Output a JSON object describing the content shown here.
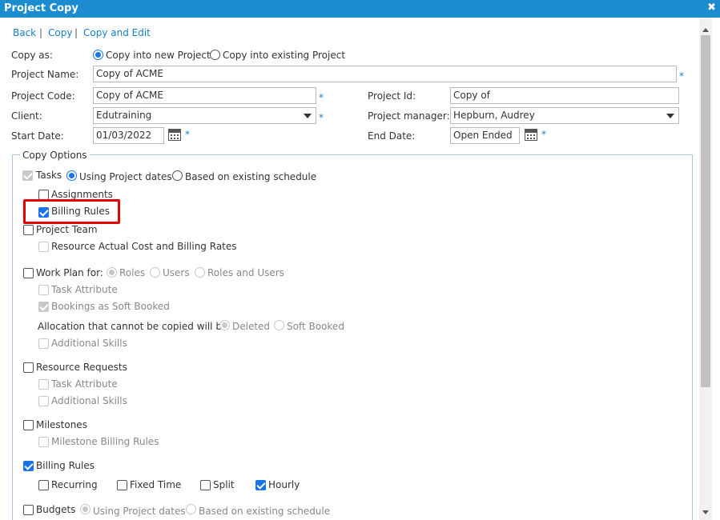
{
  "window": {
    "title": "Project Copy",
    "close": "✖"
  },
  "nav": {
    "back": "Back",
    "copy": "Copy",
    "copy_edit": "Copy and Edit",
    "sep": "|"
  },
  "copy_as": {
    "label": "Copy as:",
    "opt_new": "Copy into new Project",
    "opt_existing": "Copy into existing Project",
    "selected": "new"
  },
  "fields": {
    "project_name_label": "Project Name:",
    "project_name": "Copy of ACME",
    "project_code_label": "Project Code:",
    "project_code": "Copy of ACME",
    "project_id_label": "Project Id:",
    "project_id": "Copy of",
    "client_label": "Client:",
    "client": "Edutraining",
    "manager_label": "Project manager:",
    "manager": "Hepburn, Audrey",
    "start_label": "Start Date:",
    "start": "01/03/2022",
    "end_label": "End Date:",
    "end": "Open Ended",
    "required": "*"
  },
  "copy_options": {
    "legend": "Copy Options",
    "tasks": "Tasks",
    "using_project_dates": "Using Project dates",
    "based_on_existing": "Based on existing schedule",
    "assignments": "Assignments",
    "billing_rules_sub": "Billing Rules",
    "project_team": "Project Team",
    "resource_actual_cost": "Resource Actual Cost and Billing Rates",
    "work_plan_for": "Work Plan for:",
    "roles": "Roles",
    "users": "Users",
    "roles_and_users": "Roles and Users",
    "task_attribute": "Task Attribute",
    "bookings_soft": "Bookings as Soft Booked",
    "allocation_text": "Allocation that cannot be copied will be",
    "deleted": "Deleted",
    "soft_booked": "Soft Booked",
    "additional_skills": "Additional Skills",
    "resource_requests": "Resource Requests",
    "rr_task_attribute": "Task Attribute",
    "rr_additional_skills": "Additional Skills",
    "milestones": "Milestones",
    "milestone_billing_rules": "Milestone Billing Rules",
    "billing_rules": "Billing Rules",
    "recurring": "Recurring",
    "fixed_time": "Fixed Time",
    "split": "Split",
    "hourly": "Hourly",
    "budgets": "Budgets",
    "budgets_using": "Using Project dates",
    "budgets_based": "Based on existing schedule"
  },
  "colors": {
    "accent": "#1a8ccf",
    "link": "#1a7fc1",
    "highlight": "#e50000",
    "check": "#1a73e8"
  }
}
